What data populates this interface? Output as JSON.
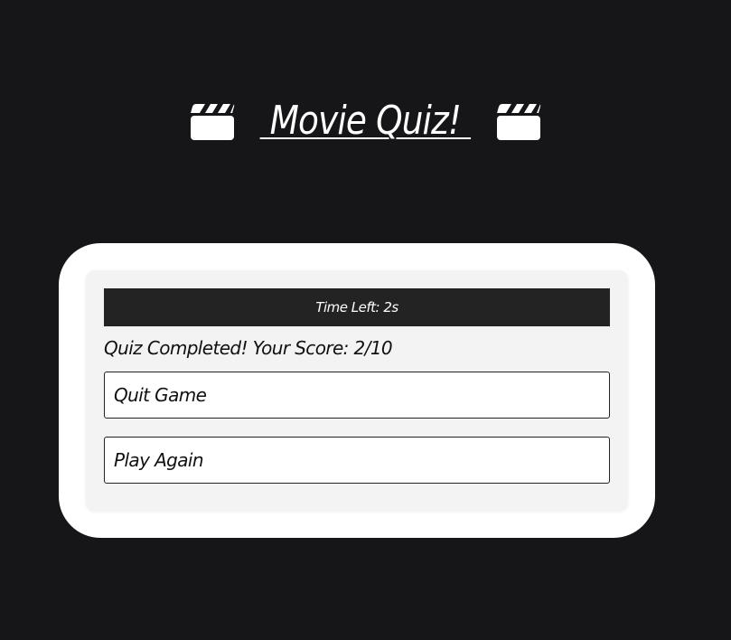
{
  "header": {
    "title": " Movie Quiz! ",
    "left_icon": "clapperboard-icon",
    "right_icon": "clapperboard-icon"
  },
  "quiz": {
    "timer_text": "Time Left: 2s",
    "result_text": "Quiz Completed! Your Score: 2/10",
    "quit_label": "Quit Game",
    "play_again_label": "Play Again"
  },
  "colors": {
    "background": "#161619",
    "card": "#ffffff",
    "inner_card": "#f3f3f3",
    "timer_bar": "#232323",
    "text_light": "#ffffff",
    "text_dark": "#111111"
  }
}
